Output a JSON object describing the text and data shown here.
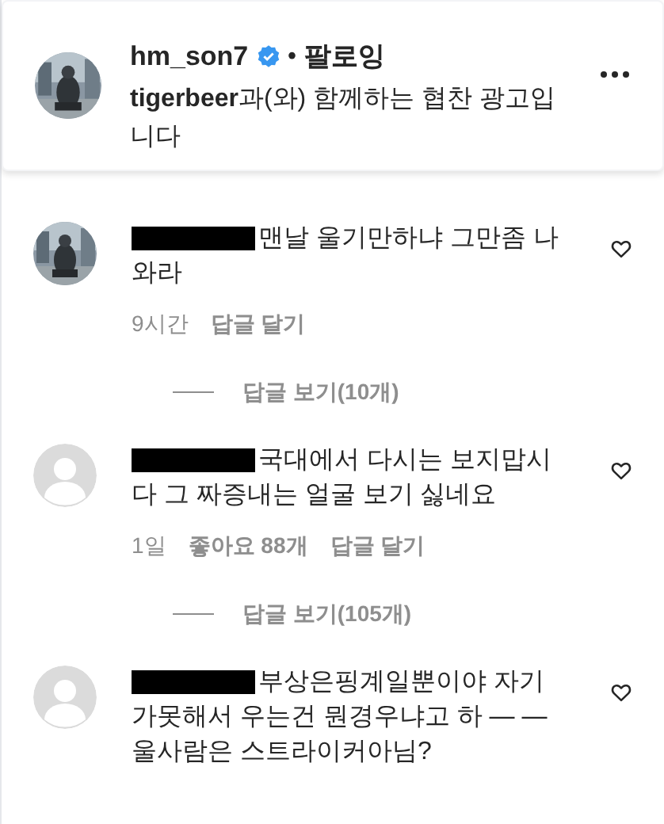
{
  "post_header": {
    "username": "hm_son7",
    "verified": true,
    "separator": "•",
    "follow_status": "팔로잉",
    "sponsor_brand": "tigerbeer",
    "sponsor_text": "과(와) 함께하는 협찬 광고입니다",
    "avatar": {
      "kind": "picture"
    }
  },
  "comments": [
    {
      "avatar": {
        "kind": "picture"
      },
      "redacted_username": true,
      "text": "맨날 울기만하냐 그만좀 나와라",
      "meta": [
        "9시간",
        "답글 달기"
      ],
      "liked": false,
      "view_replies": "답글 보기(10개)"
    },
    {
      "avatar": {
        "kind": "default"
      },
      "redacted_username": true,
      "text": "국대에서 다시는 보지맙시다 그 짜증내는 얼굴 보기 싫네요",
      "meta": [
        "1일",
        "좋아요 88개",
        "답글 달기"
      ],
      "liked": false,
      "view_replies": "답글 보기(105개)"
    },
    {
      "avatar": {
        "kind": "default"
      },
      "redacted_username": true,
      "text": "부상은핑계일뿐이야 자기가못해서 우는건 뭔경우냐고 하 — — 울사람은 스트라이커아님?",
      "liked": false
    }
  ]
}
